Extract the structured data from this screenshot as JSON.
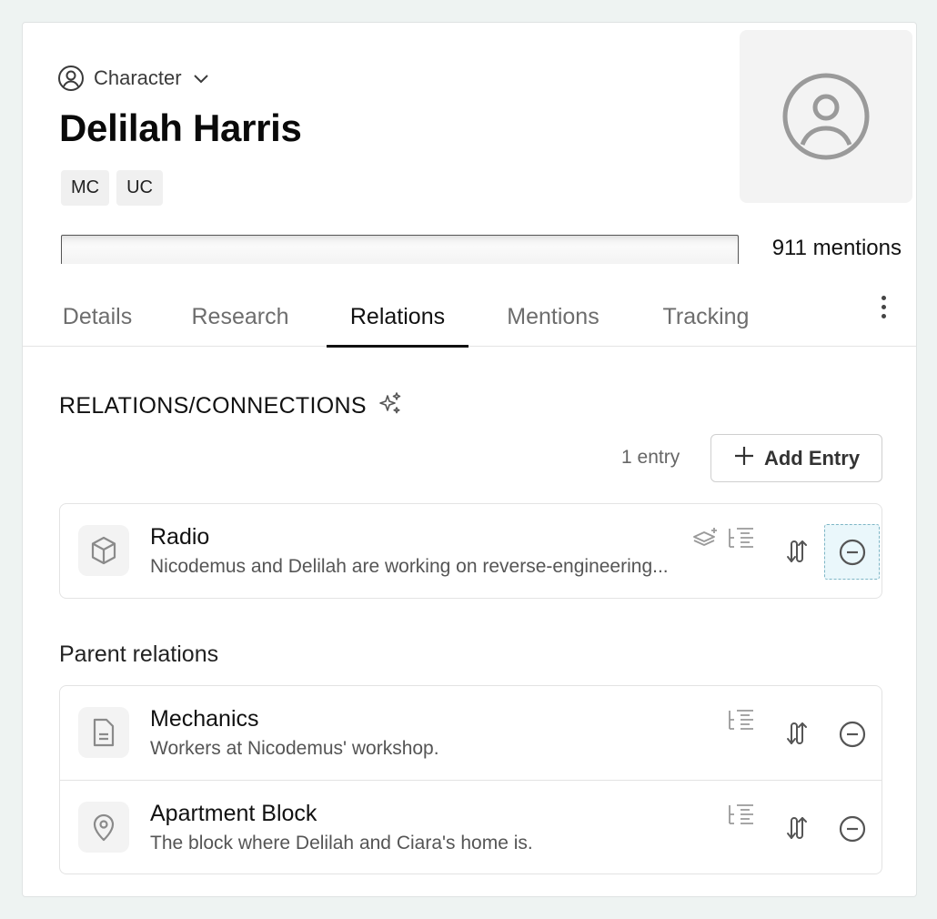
{
  "header": {
    "type_label": "Character",
    "title": "Delilah Harris",
    "tags": [
      "MC",
      "UC"
    ],
    "mentions": "911 mentions"
  },
  "tabs": [
    "Details",
    "Research",
    "Relations",
    "Mentions",
    "Tracking"
  ],
  "active_tab": "Relations",
  "relations": {
    "section_title": "RELATIONS/CONNECTIONS",
    "entry_count": "1 entry",
    "add_button": "Add Entry",
    "items": [
      {
        "icon": "cube-icon",
        "title": "Radio",
        "description": "Nicodemus and Delilah are working on reverse-engineering..."
      }
    ]
  },
  "parent_relations": {
    "label": "Parent relations",
    "items": [
      {
        "icon": "document-icon",
        "title": "Mechanics",
        "description": "Workers at Nicodemus' workshop."
      },
      {
        "icon": "location-pin-icon",
        "title": "Apartment Block",
        "description": "The block where Delilah and Ciara's home is."
      }
    ]
  },
  "colors": {
    "background": "#eef3f2",
    "active_tab_underline": "#111111",
    "remove_highlight": "#eaf7fb"
  }
}
